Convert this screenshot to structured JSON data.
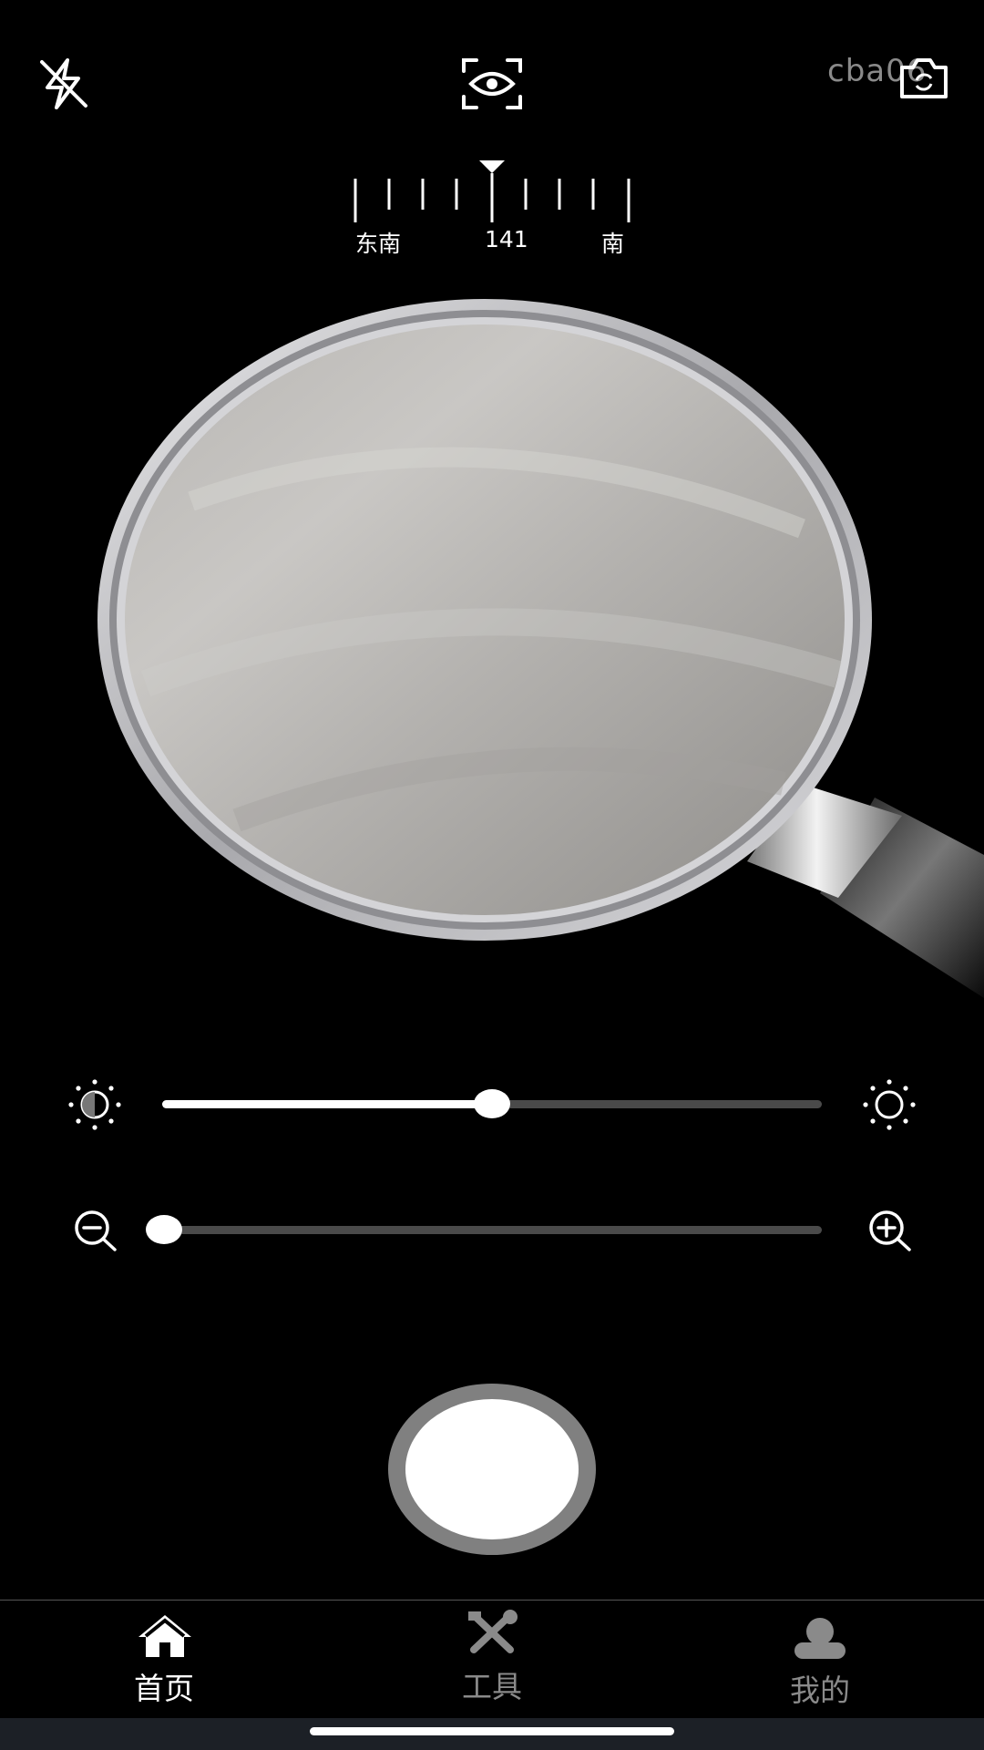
{
  "watermark": "cba06",
  "compass": {
    "left_label": "东南",
    "center_value": "141",
    "right_label": "南"
  },
  "brightness_slider": {
    "value": 0.5
  },
  "zoom_slider": {
    "value": 0.0
  },
  "tabs": [
    {
      "label": "首页",
      "icon": "home-icon",
      "active": true
    },
    {
      "label": "工具",
      "icon": "tools-icon",
      "active": false
    },
    {
      "label": "我的",
      "icon": "profile-icon",
      "active": false
    }
  ],
  "colors": {
    "background": "#000000",
    "active_tab": "#ffffff",
    "inactive_tab": "#8a8a8a"
  }
}
